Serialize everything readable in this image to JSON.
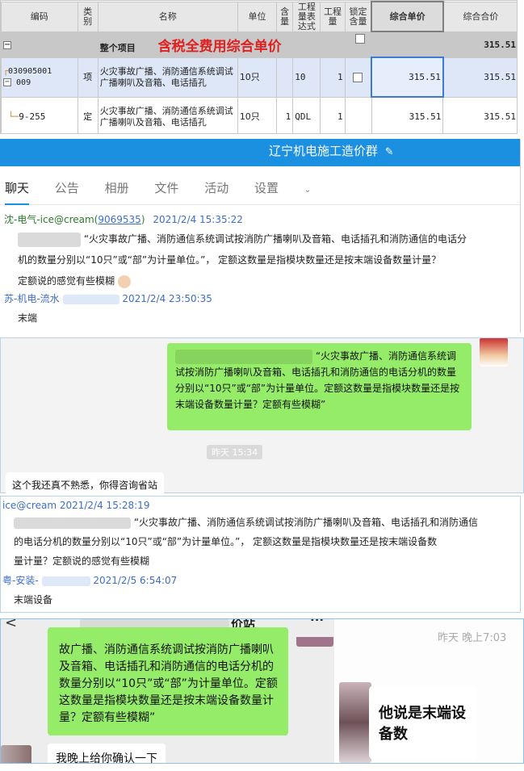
{
  "table": {
    "headers": {
      "code": "编码",
      "type": "类别",
      "name": "名称",
      "unit": "单位",
      "qty_content": "含量",
      "qty_expr": "工程量表达式",
      "qty": "工程量",
      "lock": "锁定含量",
      "unit_price": "综合单价",
      "total": "综合合价"
    },
    "annotation": "含税全费用综合单价",
    "total_row": {
      "expand_symbol": "−",
      "name": "整个项目",
      "total": "315.51"
    },
    "rows": [
      {
        "code_line1": "030905001",
        "code_line2": "009",
        "expand_symbol": "−",
        "type": "项",
        "name": "火灾事故广播、消防通信系统调试 广播喇叭及音箱、电话插孔",
        "unit": "10只",
        "content": "",
        "expr": "10",
        "qty": "1",
        "unit_price": "315.51",
        "total": "315.51"
      },
      {
        "code": "9-255",
        "type": "定",
        "name": "火灾事故广播、消防通信系统调试 广播喇叭及音箱、电话插孔",
        "unit": "10只",
        "content": "1",
        "expr": "QDL",
        "qty": "1",
        "unit_price": "315.51",
        "total": "315.51"
      }
    ]
  },
  "qq": {
    "group_title": "辽宁机电施工造价群",
    "edit_icon": "pencil-icon",
    "tabs": [
      "聊天",
      "公告",
      "相册",
      "文件",
      "活动",
      "设置"
    ],
    "active_tab": "聊天",
    "messages": [
      {
        "sender": "沈-电气-ice@cream(",
        "sender_id": "9069535",
        "sender_tail": ")",
        "time": "2021/2/4 15:35:22",
        "text_line1": "“火灾事故广播、消防通信系统调试按消防广播喇叭及音箱、电话插孔和消防通信的电话分",
        "text_line2": "机的数量分别以“10只”或“部”为计量单位。”，   定额这数量是指模块数量还是按末端设备数量计量？",
        "text_line3": "定额说的感觉有些模糊"
      },
      {
        "sender": "苏-机电-流水",
        "time": "2021/2/4 23:50:35",
        "text": "末端"
      }
    ]
  },
  "wechat": {
    "green_message": "“火灾事故广播、消防通信系统调试按消防广播喇叭及音箱、电话插孔和消防通信的电话分机的数量分别以“10只”或“部”为计量单位。定额这数量是指模块数量还是按末端设备数量计量？定额有些模糊”",
    "time_pill": "昨天 15:34",
    "reply": "这个我还真不熟悉，你得咨询省站"
  },
  "qq2": {
    "messages": [
      {
        "sender": "ice@cream",
        "time": "2021/2/4 15:28:19",
        "text_line1": "“火灾事故广播、消防通信系统调试按消防广播喇叭及音箱、电话插孔和消防通信",
        "text_line2": "的电话分机的数量分别以“10只”或“部”为计量单位。”，   定额这数量是指模块数量还是按末端设备数",
        "text_line3": "量计量？定额说的感觉有些模糊"
      },
      {
        "sender": "粤-安装-",
        "time": "2021/2/5 6:54:07",
        "text": "末端设备"
      }
    ]
  },
  "phone": {
    "back_symbol": "<",
    "title_tail": "价站",
    "more_symbol": "···",
    "green_message": "故广播、消防通信系统调试按消防广播喇叭及音箱、电话插孔和消防通信的电话分机的数量分别以“10只”或“部”为计量单位。定额这数量是指模块数量还是按末端设备数量计量？定额有些模糊”",
    "reply": "我晚上给你确认一下",
    "right_time": "昨天 晚上7:03",
    "right_bubble": "他说是末端设备数"
  },
  "colors": {
    "qq_header": "#1b8fe0",
    "wechat_green": "#95ec69",
    "annotation_red": "#e02020",
    "selection_blue": "#3a7bd5"
  }
}
